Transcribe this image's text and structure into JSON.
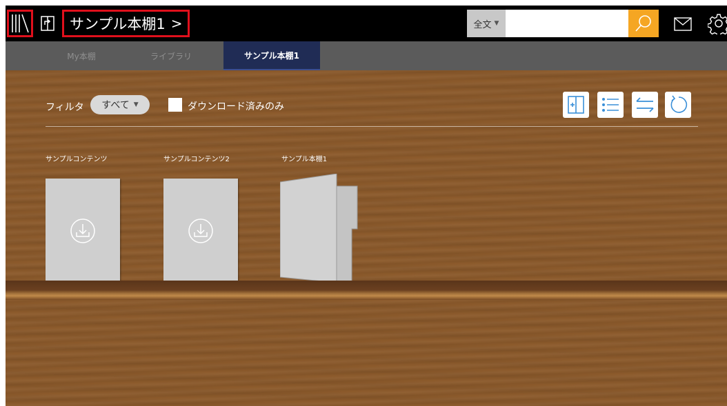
{
  "topbar": {
    "title": "サンプル本棚1",
    "title_chevron": ">",
    "search_scope": "全文",
    "search_placeholder": "",
    "icons": [
      "library-icon",
      "share-icon",
      "search-icon",
      "mail-icon",
      "gear-icon"
    ],
    "highlight_color": "#e0101c",
    "search_button_color": "#f5a623"
  },
  "tabs": [
    {
      "label": "My本棚",
      "active": false
    },
    {
      "label": "ライブラリ",
      "active": false
    },
    {
      "label": "サンプル本棚1",
      "active": true
    }
  ],
  "filter": {
    "label": "フィルタ",
    "selected": "すべて",
    "downloaded_only_label": "ダウンロード済みのみ",
    "downloaded_only_checked": false
  },
  "toolbar": [
    "add-shelf-icon",
    "list-view-icon",
    "sort-icon",
    "refresh-icon"
  ],
  "items": [
    {
      "title": "サンプルコンテンツ",
      "type": "book",
      "icon": "download-icon"
    },
    {
      "title": "サンプルコンテンツ2",
      "type": "book",
      "icon": "download-icon"
    },
    {
      "title": "サンプル本棚1",
      "type": "bookshelf-folder"
    }
  ]
}
